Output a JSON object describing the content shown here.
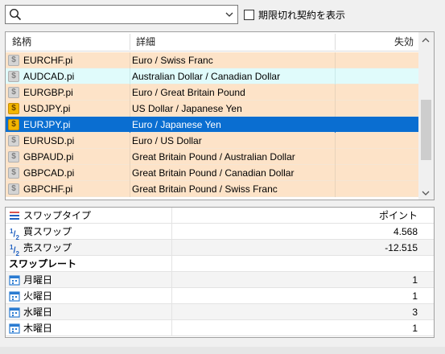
{
  "search": {
    "value": "",
    "placeholder": ""
  },
  "expired_checkbox": {
    "label": "期限切れ契約を表示",
    "checked": false
  },
  "symbols_table": {
    "columns": {
      "symbol": "銘柄",
      "description": "詳細",
      "expiry": "失効"
    },
    "rows": [
      {
        "symbol": "EURCHF.pi",
        "description": "Euro / Swiss Franc",
        "icon": "coin-grey-icon",
        "style": "orange",
        "expiry": ""
      },
      {
        "symbol": "AUDCAD.pi",
        "description": "Australian Dollar / Canadian Dollar",
        "icon": "coin-grey-icon",
        "style": "cyan",
        "expiry": ""
      },
      {
        "symbol": "EURGBP.pi",
        "description": "Euro / Great Britain Pound",
        "icon": "coin-grey-icon",
        "style": "orange",
        "expiry": ""
      },
      {
        "symbol": "USDJPY.pi",
        "description": "US Dollar / Japanese Yen",
        "icon": "coin-gold-icon",
        "style": "orange",
        "expiry": ""
      },
      {
        "symbol": "EURJPY.pi",
        "description": "Euro / Japanese Yen",
        "icon": "coin-gold-icon",
        "style": "selected",
        "expiry": ""
      },
      {
        "symbol": "EURUSD.pi",
        "description": "Euro / US Dollar",
        "icon": "coin-grey-icon",
        "style": "orange",
        "expiry": ""
      },
      {
        "symbol": "GBPAUD.pi",
        "description": "Great Britain Pound / Australian Dollar",
        "icon": "coin-grey-icon",
        "style": "orange",
        "expiry": ""
      },
      {
        "symbol": "GBPCAD.pi",
        "description": "Great Britain Pound / Canadian Dollar",
        "icon": "coin-grey-icon",
        "style": "orange",
        "expiry": ""
      },
      {
        "symbol": "GBPCHF.pi",
        "description": "Great Britain Pound / Swiss Franc",
        "icon": "coin-grey-icon",
        "style": "orange",
        "expiry": ""
      }
    ]
  },
  "swap_properties": {
    "rows": [
      {
        "kind": "header",
        "label": "スワップタイプ",
        "value": "ポイント",
        "icon": "list-icon"
      },
      {
        "kind": "item",
        "label": "買スワップ",
        "value": "4.568",
        "icon": "half-icon"
      },
      {
        "kind": "item",
        "label": "売スワップ",
        "value": "-12.515",
        "icon": "half-icon"
      },
      {
        "kind": "section",
        "label": "スワップレート",
        "value": "",
        "icon": ""
      },
      {
        "kind": "item",
        "label": "月曜日",
        "value": "1",
        "icon": "calendar-icon"
      },
      {
        "kind": "item",
        "label": "火曜日",
        "value": "1",
        "icon": "calendar-icon"
      },
      {
        "kind": "item",
        "label": "水曜日",
        "value": "3",
        "icon": "calendar-icon"
      },
      {
        "kind": "item",
        "label": "木曜日",
        "value": "1",
        "icon": "calendar-icon"
      }
    ]
  },
  "colors": {
    "row_orange": "#fde3c8",
    "row_cyan": "#e0fbfb",
    "row_selected": "#0a6ed1",
    "coin_gold": "#f2b600",
    "coin_grey": "#d4d4d4"
  }
}
